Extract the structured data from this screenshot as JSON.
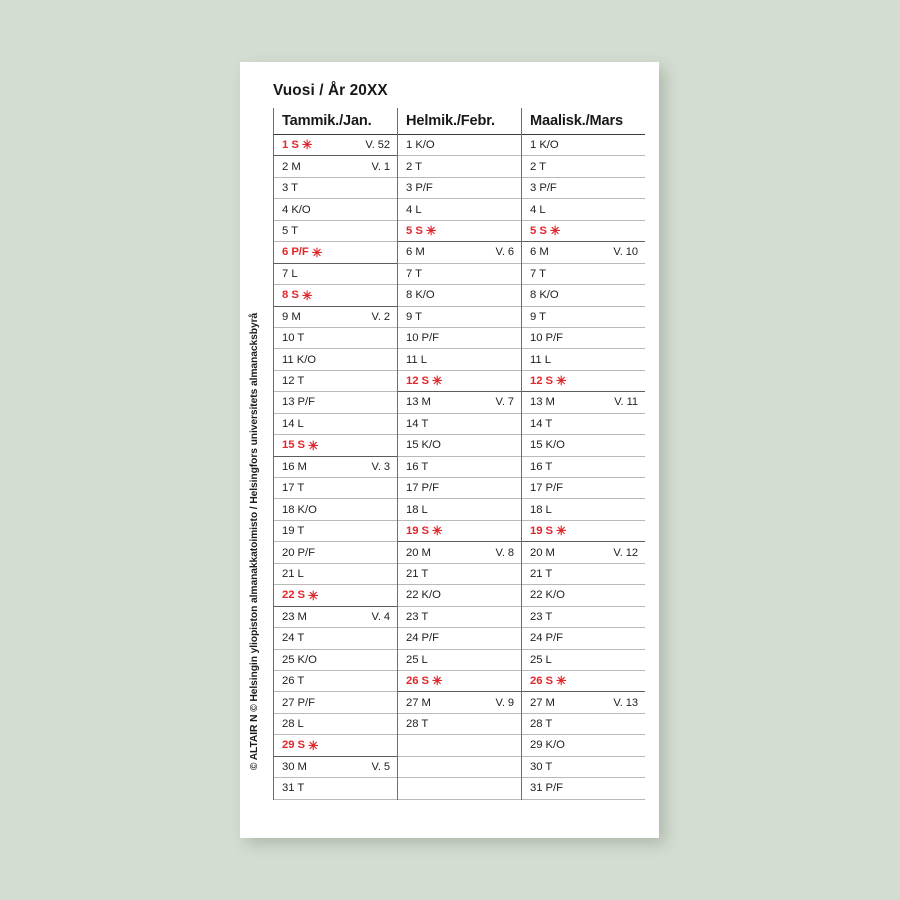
{
  "background_color": "#d4ddd1",
  "card_color": "#ffffff",
  "accent_red": "#e3262c",
  "title": "Vuosi / År 20XX",
  "credit": "© ALTAIR N © Helsingin yliopiston almanakkatoimisto / Helsingfors universitets almanacksbyrå",
  "star_glyph": "✳",
  "months": [
    {
      "name": "Tammik./Jan.",
      "days": [
        {
          "label": "1 S",
          "holiday": true,
          "star": true,
          "week": "V. 52"
        },
        {
          "label": "2 M",
          "holiday": false,
          "star": false,
          "week": "V. 1"
        },
        {
          "label": "3 T",
          "holiday": false,
          "star": false,
          "week": ""
        },
        {
          "label": "4 K/O",
          "holiday": false,
          "star": false,
          "week": ""
        },
        {
          "label": "5 T",
          "holiday": false,
          "star": false,
          "week": ""
        },
        {
          "label": "6 P/F",
          "holiday": true,
          "star": true,
          "week": ""
        },
        {
          "label": "7 L",
          "holiday": false,
          "star": false,
          "week": ""
        },
        {
          "label": "8 S",
          "holiday": true,
          "star": true,
          "week": ""
        },
        {
          "label": "9 M",
          "holiday": false,
          "star": false,
          "week": "V. 2"
        },
        {
          "label": "10 T",
          "holiday": false,
          "star": false,
          "week": ""
        },
        {
          "label": "11 K/O",
          "holiday": false,
          "star": false,
          "week": ""
        },
        {
          "label": "12 T",
          "holiday": false,
          "star": false,
          "week": ""
        },
        {
          "label": "13 P/F",
          "holiday": false,
          "star": false,
          "week": ""
        },
        {
          "label": "14 L",
          "holiday": false,
          "star": false,
          "week": ""
        },
        {
          "label": "15 S",
          "holiday": true,
          "star": true,
          "week": ""
        },
        {
          "label": "16 M",
          "holiday": false,
          "star": false,
          "week": "V. 3"
        },
        {
          "label": "17 T",
          "holiday": false,
          "star": false,
          "week": ""
        },
        {
          "label": "18 K/O",
          "holiday": false,
          "star": false,
          "week": ""
        },
        {
          "label": "19 T",
          "holiday": false,
          "star": false,
          "week": ""
        },
        {
          "label": "20 P/F",
          "holiday": false,
          "star": false,
          "week": ""
        },
        {
          "label": "21 L",
          "holiday": false,
          "star": false,
          "week": ""
        },
        {
          "label": "22 S",
          "holiday": true,
          "star": true,
          "week": ""
        },
        {
          "label": "23 M",
          "holiday": false,
          "star": false,
          "week": "V. 4"
        },
        {
          "label": "24 T",
          "holiday": false,
          "star": false,
          "week": ""
        },
        {
          "label": "25 K/O",
          "holiday": false,
          "star": false,
          "week": ""
        },
        {
          "label": "26 T",
          "holiday": false,
          "star": false,
          "week": ""
        },
        {
          "label": "27 P/F",
          "holiday": false,
          "star": false,
          "week": ""
        },
        {
          "label": "28 L",
          "holiday": false,
          "star": false,
          "week": ""
        },
        {
          "label": "29 S",
          "holiday": true,
          "star": true,
          "week": ""
        },
        {
          "label": "30 M",
          "holiday": false,
          "star": false,
          "week": "V. 5"
        },
        {
          "label": "31 T",
          "holiday": false,
          "star": false,
          "week": ""
        }
      ]
    },
    {
      "name": "Helmik./Febr.",
      "days": [
        {
          "label": "1 K/O",
          "holiday": false,
          "star": false,
          "week": ""
        },
        {
          "label": "2 T",
          "holiday": false,
          "star": false,
          "week": ""
        },
        {
          "label": "3 P/F",
          "holiday": false,
          "star": false,
          "week": ""
        },
        {
          "label": "4 L",
          "holiday": false,
          "star": false,
          "week": ""
        },
        {
          "label": "5 S",
          "holiday": true,
          "star": true,
          "week": ""
        },
        {
          "label": "6 M",
          "holiday": false,
          "star": false,
          "week": "V. 6"
        },
        {
          "label": "7 T",
          "holiday": false,
          "star": false,
          "week": ""
        },
        {
          "label": "8 K/O",
          "holiday": false,
          "star": false,
          "week": ""
        },
        {
          "label": "9 T",
          "holiday": false,
          "star": false,
          "week": ""
        },
        {
          "label": "10 P/F",
          "holiday": false,
          "star": false,
          "week": ""
        },
        {
          "label": "11 L",
          "holiday": false,
          "star": false,
          "week": ""
        },
        {
          "label": "12 S",
          "holiday": true,
          "star": true,
          "week": ""
        },
        {
          "label": "13 M",
          "holiday": false,
          "star": false,
          "week": "V. 7"
        },
        {
          "label": "14 T",
          "holiday": false,
          "star": false,
          "week": ""
        },
        {
          "label": "15 K/O",
          "holiday": false,
          "star": false,
          "week": ""
        },
        {
          "label": "16 T",
          "holiday": false,
          "star": false,
          "week": ""
        },
        {
          "label": "17 P/F",
          "holiday": false,
          "star": false,
          "week": ""
        },
        {
          "label": "18 L",
          "holiday": false,
          "star": false,
          "week": ""
        },
        {
          "label": "19 S",
          "holiday": true,
          "star": true,
          "week": ""
        },
        {
          "label": "20 M",
          "holiday": false,
          "star": false,
          "week": "V. 8"
        },
        {
          "label": "21 T",
          "holiday": false,
          "star": false,
          "week": ""
        },
        {
          "label": "22 K/O",
          "holiday": false,
          "star": false,
          "week": ""
        },
        {
          "label": "23 T",
          "holiday": false,
          "star": false,
          "week": ""
        },
        {
          "label": "24 P/F",
          "holiday": false,
          "star": false,
          "week": ""
        },
        {
          "label": "25 L",
          "holiday": false,
          "star": false,
          "week": ""
        },
        {
          "label": "26 S",
          "holiday": true,
          "star": true,
          "week": ""
        },
        {
          "label": "27 M",
          "holiday": false,
          "star": false,
          "week": "V. 9"
        },
        {
          "label": "28 T",
          "holiday": false,
          "star": false,
          "week": ""
        },
        {
          "label": "",
          "holiday": false,
          "star": false,
          "week": ""
        },
        {
          "label": "",
          "holiday": false,
          "star": false,
          "week": ""
        },
        {
          "label": "",
          "holiday": false,
          "star": false,
          "week": ""
        }
      ]
    },
    {
      "name": "Maalisk./Mars",
      "days": [
        {
          "label": "1 K/O",
          "holiday": false,
          "star": false,
          "week": ""
        },
        {
          "label": "2 T",
          "holiday": false,
          "star": false,
          "week": ""
        },
        {
          "label": "3 P/F",
          "holiday": false,
          "star": false,
          "week": ""
        },
        {
          "label": "4 L",
          "holiday": false,
          "star": false,
          "week": ""
        },
        {
          "label": "5 S",
          "holiday": true,
          "star": true,
          "week": ""
        },
        {
          "label": "6 M",
          "holiday": false,
          "star": false,
          "week": "V. 10"
        },
        {
          "label": "7 T",
          "holiday": false,
          "star": false,
          "week": ""
        },
        {
          "label": "8 K/O",
          "holiday": false,
          "star": false,
          "week": ""
        },
        {
          "label": "9 T",
          "holiday": false,
          "star": false,
          "week": ""
        },
        {
          "label": "10 P/F",
          "holiday": false,
          "star": false,
          "week": ""
        },
        {
          "label": "11 L",
          "holiday": false,
          "star": false,
          "week": ""
        },
        {
          "label": "12 S",
          "holiday": true,
          "star": true,
          "week": ""
        },
        {
          "label": "13 M",
          "holiday": false,
          "star": false,
          "week": "V. 11"
        },
        {
          "label": "14 T",
          "holiday": false,
          "star": false,
          "week": ""
        },
        {
          "label": "15 K/O",
          "holiday": false,
          "star": false,
          "week": ""
        },
        {
          "label": "16 T",
          "holiday": false,
          "star": false,
          "week": ""
        },
        {
          "label": "17 P/F",
          "holiday": false,
          "star": false,
          "week": ""
        },
        {
          "label": "18 L",
          "holiday": false,
          "star": false,
          "week": ""
        },
        {
          "label": "19 S",
          "holiday": true,
          "star": true,
          "week": ""
        },
        {
          "label": "20 M",
          "holiday": false,
          "star": false,
          "week": "V. 12"
        },
        {
          "label": "21 T",
          "holiday": false,
          "star": false,
          "week": ""
        },
        {
          "label": "22 K/O",
          "holiday": false,
          "star": false,
          "week": ""
        },
        {
          "label": "23 T",
          "holiday": false,
          "star": false,
          "week": ""
        },
        {
          "label": "24 P/F",
          "holiday": false,
          "star": false,
          "week": ""
        },
        {
          "label": "25 L",
          "holiday": false,
          "star": false,
          "week": ""
        },
        {
          "label": "26 S",
          "holiday": true,
          "star": true,
          "week": ""
        },
        {
          "label": "27 M",
          "holiday": false,
          "star": false,
          "week": "V. 13"
        },
        {
          "label": "28 T",
          "holiday": false,
          "star": false,
          "week": ""
        },
        {
          "label": "29 K/O",
          "holiday": false,
          "star": false,
          "week": ""
        },
        {
          "label": "30 T",
          "holiday": false,
          "star": false,
          "week": ""
        },
        {
          "label": "31 P/F",
          "holiday": false,
          "star": false,
          "week": ""
        }
      ]
    }
  ]
}
